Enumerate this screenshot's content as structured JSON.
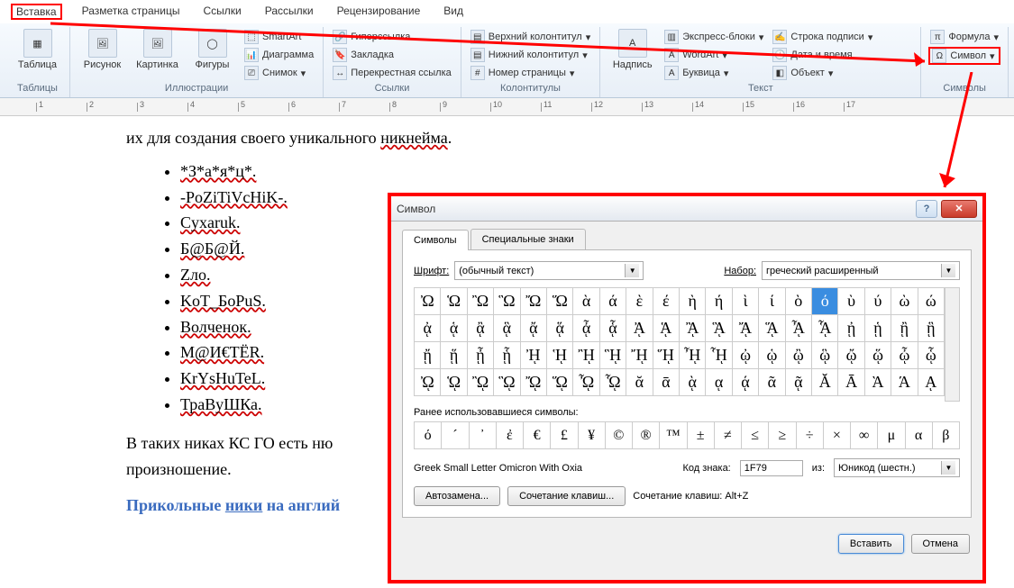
{
  "menu": {
    "items": [
      "Вставка",
      "Разметка страницы",
      "Ссылки",
      "Рассылки",
      "Рецензирование",
      "Вид"
    ]
  },
  "ribbon": {
    "tables": {
      "label": "Таблицы",
      "table": "Таблица"
    },
    "illustrations": {
      "label": "Иллюстрации",
      "picture": "Рисунок",
      "clipart": "Картинка",
      "shapes": "Фигуры",
      "smartart": "SmartArt",
      "chart": "Диаграмма",
      "screenshot": "Снимок"
    },
    "links": {
      "label": "Ссылки",
      "hyperlink": "Гиперссылка",
      "bookmark": "Закладка",
      "crossref": "Перекрестная ссылка"
    },
    "headers": {
      "label": "Колонтитулы",
      "header": "Верхний колонтитул",
      "footer": "Нижний колонтитул",
      "pagenum": "Номер страницы"
    },
    "textgrp": {
      "label": "Текст",
      "textbox": "Надпись",
      "quickparts": "Экспресс-блоки",
      "wordart": "WordArt",
      "dropcap": "Буквица",
      "sigline": "Строка подписи",
      "datetime": "Дата и время",
      "object": "Объект"
    },
    "symbols": {
      "label": "Символы",
      "equation": "Формула",
      "symbol": "Символ"
    }
  },
  "doc": {
    "intro_pre": "их для создания своего уникального ",
    "intro_nick": "никнейма",
    "intro_post": ".",
    "nicks": [
      "*З*а*я*ц*.",
      "-PoZiTiVcHiK-.",
      "Cyxaruk.",
      "Б@Б@Й.",
      "Zло.",
      "KoT_БoPuS.",
      "Волченок.",
      "M@И€TËR.",
      "KrYsHuTeL.",
      "ТраВуШКа."
    ],
    "para2": "В таких никах КС ГО есть ню",
    "para2b": "произношение.",
    "blue_pre": "Прикольные ",
    "blue_u": "ники",
    "blue_post": " на англий"
  },
  "dialog": {
    "title": "Символ",
    "tabs": [
      "Символы",
      "Специальные знаки"
    ],
    "font_label": "Шрифт:",
    "font_value": "(обычный текст)",
    "set_label": "Набор:",
    "set_value": "греческий расширенный",
    "recent_label": "Ранее использовавшиеся символы:",
    "charname": "Greek Small Letter Omicron With Oxia",
    "code_label": "Код знака:",
    "code_value": "1F79",
    "from_label": "из:",
    "from_value": "Юникод (шестн.)",
    "autocorrect": "Автозамена...",
    "shortcut_btn": "Сочетание клавиш...",
    "shortcut_label": "Сочетание клавиш: Alt+Z",
    "insert": "Вставить",
    "cancel": "Отмена",
    "grid": [
      [
        "Ὠ",
        "Ὡ",
        "Ὢ",
        "Ὣ",
        "Ὤ",
        "Ὥ",
        "ὰ",
        "ά",
        "ὲ",
        "έ",
        "ὴ",
        "ή",
        "ὶ",
        "ί",
        "ὸ",
        "ό",
        "ὺ",
        "ύ",
        "ὼ",
        "ώ"
      ],
      [
        "ᾀ",
        "ᾁ",
        "ᾂ",
        "ᾃ",
        "ᾄ",
        "ᾅ",
        "ᾆ",
        "ᾇ",
        "ᾈ",
        "ᾉ",
        "ᾊ",
        "ᾋ",
        "ᾌ",
        "ᾍ",
        "ᾎ",
        "ᾏ",
        "ᾐ",
        "ᾑ",
        "ᾒ",
        "ᾓ"
      ],
      [
        "ᾔ",
        "ᾕ",
        "ᾖ",
        "ᾗ",
        "ᾘ",
        "ᾙ",
        "ᾚ",
        "ᾛ",
        "ᾜ",
        "ᾝ",
        "ᾞ",
        "ᾟ",
        "ᾠ",
        "ᾡ",
        "ᾢ",
        "ᾣ",
        "ᾤ",
        "ᾥ",
        "ᾦ",
        "ᾧ"
      ],
      [
        "ᾨ",
        "ᾩ",
        "ᾪ",
        "ᾫ",
        "ᾬ",
        "ᾭ",
        "ᾮ",
        "ᾯ",
        "ᾰ",
        "ᾱ",
        "ᾲ",
        "ᾳ",
        "ᾴ",
        "ᾶ",
        "ᾷ",
        "Ᾰ",
        "Ᾱ",
        "Ὰ",
        "Ά",
        "ᾼ"
      ]
    ],
    "selected_row": 0,
    "selected_col": 15,
    "recent": [
      "ό",
      "´",
      "᾿",
      "ἐ",
      "€",
      "£",
      "¥",
      "©",
      "®",
      "™",
      "±",
      "≠",
      "≤",
      "≥",
      "÷",
      "×",
      "∞",
      "μ",
      "α",
      "β"
    ]
  }
}
